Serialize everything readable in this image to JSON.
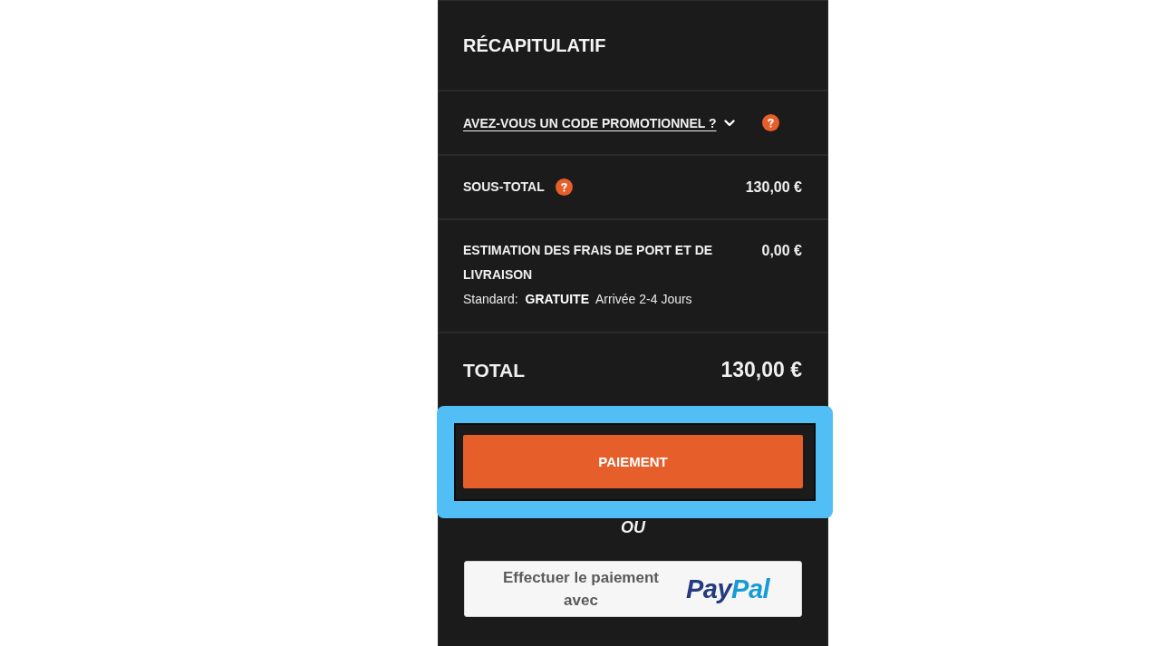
{
  "summary": {
    "title": "RÉCAPITULATIF",
    "promo": {
      "label": "AVEZ-VOUS UN CODE PROMOTIONNEL ?",
      "expanded": false
    },
    "subtotal": {
      "label": "SOUS-TOTAL",
      "value": "130,00 €"
    },
    "shipping": {
      "label": "ESTIMATION DES FRAIS DE PORT ET DE LIVRAISON",
      "value": "0,00 €",
      "detail": "Standard:  **GRATUITE**  Arrivée 2-4 Jours"
    },
    "total": {
      "label": "TOTAL",
      "value": "130,00 €"
    },
    "checkout_button": {
      "label": "PAIEMENT",
      "highlighted": true
    },
    "separator": "OU",
    "paypal_button": {
      "label": "Effectuer le paiement avec",
      "logo": [
        {
          "text": "Pay",
          "color": "#253b80"
        },
        {
          "text": "Pal",
          "color": "#179bd7"
        }
      ]
    }
  }
}
